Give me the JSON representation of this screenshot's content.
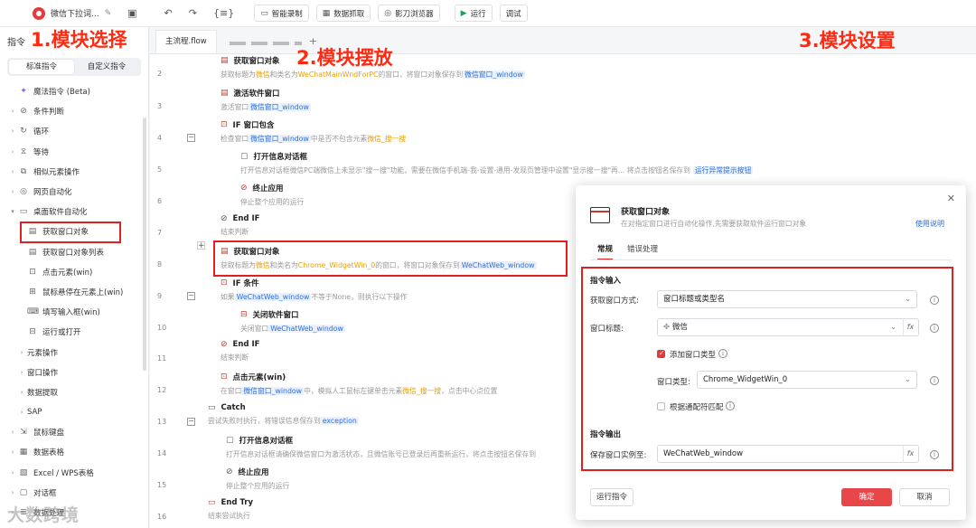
{
  "toolbar": {
    "title": "微信下拉词...",
    "smart_record": "智能录制",
    "data_grab": "数据抓取",
    "browser": "影刀浏览器",
    "run": "运行",
    "debug": "调试"
  },
  "left_panel": {
    "title": "指令",
    "tab_standard": "标准指令",
    "tab_custom": "自定义指令",
    "items": [
      {
        "label": "魔法指令 (Beta)",
        "icon": "magic-icon",
        "level": 0
      },
      {
        "label": "条件判断",
        "icon": "condition-icon",
        "level": 1
      },
      {
        "label": "循环",
        "icon": "loop-icon",
        "level": 1
      },
      {
        "label": "等待",
        "icon": "wait-icon",
        "level": 1
      },
      {
        "label": "相似元素操作",
        "icon": "similar-icon",
        "level": 1
      },
      {
        "label": "网页自动化",
        "icon": "web-icon",
        "level": 1
      },
      {
        "label": "桌面软件自动化",
        "icon": "desktop-icon",
        "level": 1
      },
      {
        "label": "获取窗口对象",
        "icon": "window-icon",
        "level": 2
      },
      {
        "label": "获取窗口对象列表",
        "icon": "window-list-icon",
        "level": 2
      },
      {
        "label": "点击元素(win)",
        "icon": "click-icon",
        "level": 2
      },
      {
        "label": "鼠标悬停在元素上(win)",
        "icon": "hover-icon",
        "level": 2
      },
      {
        "label": "填写输入框(win)",
        "icon": "input-icon",
        "level": 2
      },
      {
        "label": "运行或打开",
        "icon": "run-open-icon",
        "level": 2
      },
      {
        "label": "元素操作",
        "icon": "",
        "level": 3
      },
      {
        "label": "窗口操作",
        "icon": "",
        "level": 3
      },
      {
        "label": "数据提取",
        "icon": "",
        "level": 3
      },
      {
        "label": "SAP",
        "icon": "",
        "level": 3
      },
      {
        "label": "鼠标键盘",
        "icon": "mouse-icon",
        "level": 1
      },
      {
        "label": "数据表格",
        "icon": "table-icon",
        "level": 1
      },
      {
        "label": "Excel / WPS表格",
        "icon": "excel-icon",
        "level": 1
      },
      {
        "label": "对话框",
        "icon": "dialog-icon",
        "level": 1
      },
      {
        "label": "数据处理",
        "icon": "data-icon",
        "level": 1
      }
    ]
  },
  "canvas": {
    "tab_main": "主流程.flow",
    "steps": [
      {
        "ln": "2",
        "title": "获取窗口对象",
        "desc_parts": [
          "获取标题为",
          "微信",
          "和类名为",
          "WeChatMainWndForPC",
          "的窗口，将窗口对象保存到",
          "微信窗口_window"
        ]
      },
      {
        "ln": "3",
        "title": "激活软件窗口",
        "desc_parts": [
          "激活窗口",
          "微信窗口_window"
        ]
      },
      {
        "ln": "4",
        "title": "IF 窗口包含",
        "desc_parts": [
          "检查窗口",
          "微信窗口_window",
          "中是否不包含元素",
          "微信_搜一搜"
        ]
      },
      {
        "ln": "5",
        "title": "打开信息对话框",
        "desc": "打开信息对话框微信PC端微信上未显示\"搜一搜\"功能，需要在微信手机端-我-设置-通用-发现页管理中设置\"显示搜一搜\"再...  将点击按钮名保存到",
        "chip": "运行异常提示按钮"
      },
      {
        "ln": "6",
        "title": "终止应用",
        "desc": "停止整个应用的运行"
      },
      {
        "ln": "7",
        "title": "End IF",
        "desc": "结束判断"
      },
      {
        "ln": "8",
        "title": "获取窗口对象",
        "desc_parts": [
          "获取标题为",
          "微信",
          "和类名为",
          "Chrome_WidgetWin_0",
          "的窗口，将窗口对象保存到",
          "WeChatWeb_window"
        ]
      },
      {
        "ln": "9",
        "title": "IF 条件",
        "desc_parts": [
          "如果",
          "WeChatWeb_window",
          "不等于None，则执行以下操作"
        ]
      },
      {
        "ln": "10",
        "title": "关闭软件窗口",
        "desc_parts": [
          "关闭窗口",
          "WeChatWeb_window"
        ]
      },
      {
        "ln": "11",
        "title": "End IF",
        "desc": "结束判断"
      },
      {
        "ln": "12",
        "title": "点击元素(win)",
        "desc_parts": [
          "在窗口",
          "微信窗口_window",
          "中，模拟人工鼠标左键单击元素",
          "微信_搜一搜",
          "，点击中心点位置"
        ]
      },
      {
        "ln": "13",
        "title": "Catch",
        "desc_parts": [
          "尝试失败时执行，将错误信息保存到",
          "exception"
        ]
      },
      {
        "ln": "14",
        "title": "打开信息对话框",
        "desc": "打开信息对话框请确保微信窗口为激活状态，且微信账号已登录后再重新运行，将点击按钮名保存到"
      },
      {
        "ln": "15",
        "title": "终止应用",
        "desc": "停止整个应用的运行"
      },
      {
        "ln": "16",
        "title": "End Try",
        "desc": "结束尝试执行"
      }
    ]
  },
  "annotations": {
    "a1": "1.模块选择",
    "a2": "2.模块摆放",
    "a3": "3.模块设置"
  },
  "dialog": {
    "title": "获取窗口对象",
    "subtitle": "在对指定窗口进行自动化操作,先需要获取软件运行窗口对象",
    "help": "使用说明",
    "tab_general": "常规",
    "tab_error": "错误处理",
    "section_input": "指令输入",
    "label_method": "获取窗口方式:",
    "value_method": "窗口标题或类型名",
    "label_title": "窗口标题:",
    "value_title": "微信",
    "check_add_type": "添加窗口类型",
    "label_type": "窗口类型:",
    "value_type": "Chrome_WidgetWin_0",
    "check_wildcard": "根据通配符匹配",
    "section_output": "指令输出",
    "label_save": "保存窗口实例至:",
    "value_save": "WeChatWeb_window",
    "btn_run": "运行指令",
    "btn_ok": "确定",
    "btn_cancel": "取消"
  },
  "watermark": "大数跨境"
}
